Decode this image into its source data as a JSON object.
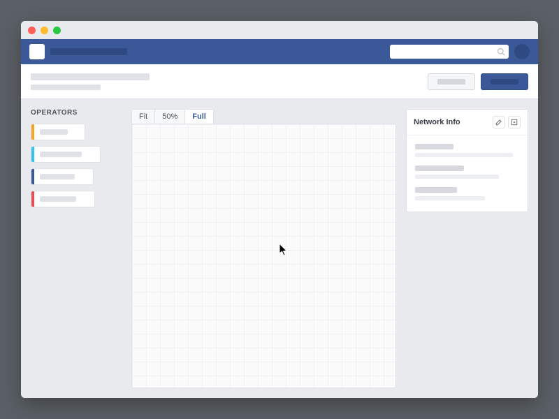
{
  "colors": {
    "brand": "#3b5998",
    "op_orange": "#f5a523",
    "op_cyan": "#33c3f0",
    "op_blue": "#3b5998",
    "op_red": "#f04b54"
  },
  "topnav": {
    "search_placeholder": ""
  },
  "subheader": {
    "secondary_label": "",
    "primary_label": ""
  },
  "sidebar": {
    "heading": "OPERATORS",
    "items": [
      {
        "color": "#f5a523"
      },
      {
        "color": "#33c3f0"
      },
      {
        "color": "#3b5998"
      },
      {
        "color": "#f04b54"
      }
    ]
  },
  "canvas": {
    "zoom_options": [
      "Fit",
      "50%",
      "Full"
    ],
    "zoom_active": "Full"
  },
  "info_panel": {
    "title": "Network Info"
  }
}
